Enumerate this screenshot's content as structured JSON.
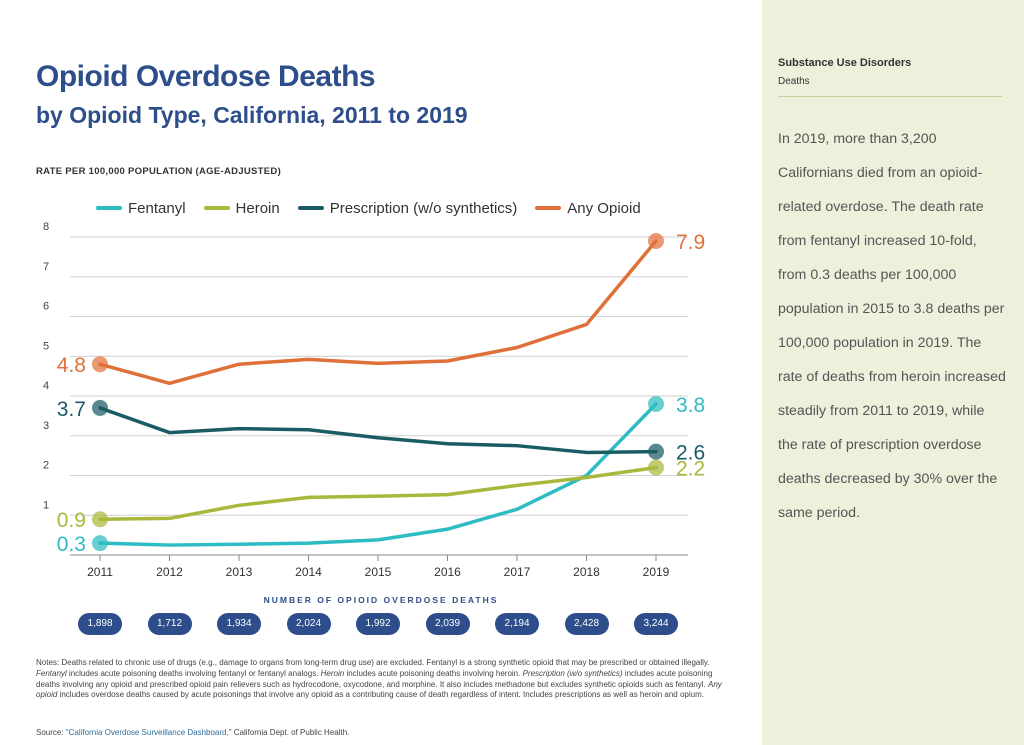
{
  "header": {
    "title": "Opioid Overdose Deaths",
    "subtitle": "by Opioid Type, California, 2011 to 2019",
    "y_axis_caption": "RATE PER 100,000 POPULATION (AGE-ADJUSTED)"
  },
  "chart_data": {
    "type": "line",
    "x": [
      "2011",
      "2012",
      "2013",
      "2014",
      "2015",
      "2016",
      "2017",
      "2018",
      "2019"
    ],
    "yticks": [
      "1",
      "2",
      "3",
      "4",
      "5",
      "6",
      "7",
      "8"
    ],
    "ylim": [
      0,
      8
    ],
    "grid": true,
    "legend_position": "top",
    "series": [
      {
        "name": "Fentanyl",
        "color": "#2dbcc3",
        "values": [
          0.3,
          0.25,
          0.27,
          0.3,
          0.38,
          0.65,
          1.15,
          2.0,
          3.8
        ],
        "start_label": "0.3",
        "end_label": "3.8"
      },
      {
        "name": "Heroin",
        "color": "#a9b83c",
        "values": [
          0.9,
          0.92,
          1.25,
          1.45,
          1.48,
          1.52,
          1.75,
          1.95,
          2.2
        ],
        "start_label": "0.9",
        "end_label": "2.2"
      },
      {
        "name": "Prescription (w/o synthetics)",
        "color": "#1a5c64",
        "values": [
          3.7,
          3.08,
          3.18,
          3.15,
          2.95,
          2.8,
          2.75,
          2.58,
          2.6
        ],
        "start_label": "3.7",
        "end_label": "2.6"
      },
      {
        "name": "Any Opioid",
        "color": "#e0703a",
        "values": [
          4.8,
          4.32,
          4.8,
          4.92,
          4.82,
          4.88,
          5.22,
          5.8,
          7.9
        ],
        "start_label": "4.8",
        "end_label": "7.9"
      }
    ],
    "overdose_deaths_title": "NUMBER OF OPIOID OVERDOSE DEATHS",
    "overdose_deaths": [
      "1,898",
      "1,712",
      "1,934",
      "2,024",
      "1,992",
      "2,039",
      "2,194",
      "2,428",
      "3,244"
    ]
  },
  "notes": {
    "text_1": "Notes: Deaths related to chronic use of drugs (e.g., damage to organs from long-term drug use) are excluded. Fentanyl is a strong synthetic opioid that may be prescribed or obtained illegally. ",
    "term_fentanyl": "Fentanyl",
    "text_2": " includes acute poisoning deaths involving fentanyl or fentanyl analogs. ",
    "term_heroin": "Heroin",
    "text_3": " includes acute poisoning deaths involving heroin. ",
    "term_prescription": "Prescription (w/o synthetics)",
    "text_4": " includes acute poisoning deaths involving any opioid and prescribed opioid pain relievers such as hydrocodone, oxycodone, and morphine. It also includes methadone but excludes synthetic opioids such as fentanyl. ",
    "term_any": "Any opioid",
    "text_5": " includes overdose deaths caused by acute poisonings that involve any opioid as a contributing cause of death regardless of intent. Includes prescriptions as well as heroin and opium."
  },
  "source": {
    "prefix": "Source: ",
    "link": "\"California Overdose Surveillance Dashboard,\"",
    "suffix": " California Dept. of Public Health."
  },
  "sidebar": {
    "category": "Substance Use Disorders",
    "topic": "Deaths",
    "body": "In 2019, more than 3,200 Californians died from an opioid-related overdose. The death rate from fentanyl increased 10-fold, from 0.3 deaths per 100,000 population in 2015 to 3.8 deaths per 100,000 population in 2019. The rate of deaths from heroin increased steadily from 2011 to 2019, while the rate of prescription overdose deaths decreased by 30% over the same period."
  }
}
